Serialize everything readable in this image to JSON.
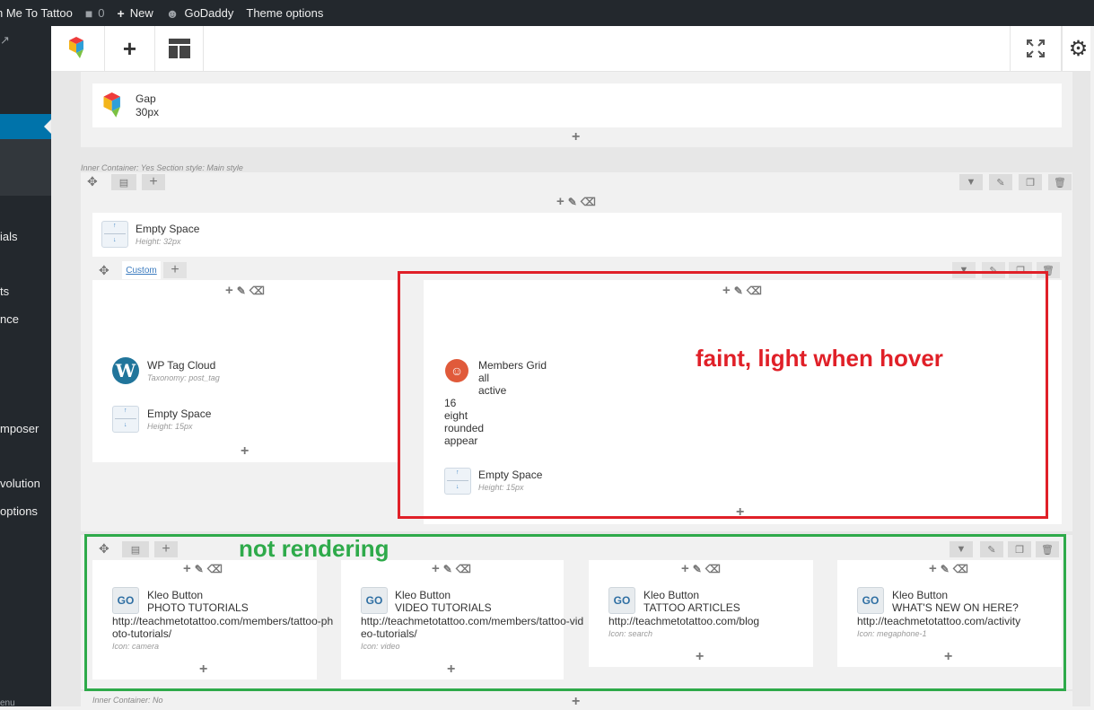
{
  "adminbar": {
    "site_name": "h Me To Tattoo",
    "comments_count": "0",
    "new_label": "New",
    "godaddy_label": "GoDaddy",
    "theme_options_label": "Theme options"
  },
  "sidebar": {
    "items": [
      {
        "label": "ials"
      },
      {
        "label": "ts"
      },
      {
        "label": "nce"
      },
      {
        "label": "mposer"
      },
      {
        "label": "volution"
      },
      {
        "label": "options"
      },
      {
        "label": "enu"
      }
    ]
  },
  "gap_element": {
    "title": "Gap",
    "value": "30px"
  },
  "inner_container_1": "Inner Container: Yes  Section style: Main style",
  "empty_space_top": {
    "title": "Empty Space",
    "height": "Height: 32px"
  },
  "custom_tab_label": "Custom",
  "tag_cloud": {
    "title": "WP Tag Cloud",
    "taxonomy": "Taxonomy: post_tag"
  },
  "empty_space_left": {
    "title": "Empty Space",
    "height": "Height: 15px"
  },
  "members_grid": {
    "title": "Members Grid",
    "lines_indented": [
      "all",
      "active"
    ],
    "lines": [
      "16",
      "eight",
      "rounded",
      "appear"
    ]
  },
  "empty_space_right": {
    "title": "Empty Space",
    "height": "Height: 15px"
  },
  "buttons": [
    {
      "title": "Kleo Button",
      "label": "PHOTO TUTORIALS",
      "url": "http://teachmetotattoo.com/members/tattoo-photo-tutorials/",
      "icon": "Icon: camera"
    },
    {
      "title": "Kleo Button",
      "label": "VIDEO TUTORIALS",
      "url": "http://teachmetotattoo.com/members/tattoo-video-tutorials/",
      "icon": "Icon: video"
    },
    {
      "title": "Kleo Button",
      "label": "TATTOO ARTICLES",
      "url": "http://teachmetotattoo.com/blog",
      "icon": "Icon: search"
    },
    {
      "title": "Kleo Button",
      "label": "WHAT'S NEW ON HERE?",
      "url": "http://teachmetotattoo.com/activity",
      "icon": "Icon: megaphone-1"
    }
  ],
  "go_icon_text": "GO",
  "inner_container_2": "Inner Container: No",
  "annotations": {
    "red": "faint, light when hover",
    "green": "not rendering"
  },
  "colors": {
    "admin_bar": "#23282d",
    "active_menu": "#0073aa",
    "annotation_red": "#e02028",
    "annotation_green": "#2eaa4a"
  }
}
